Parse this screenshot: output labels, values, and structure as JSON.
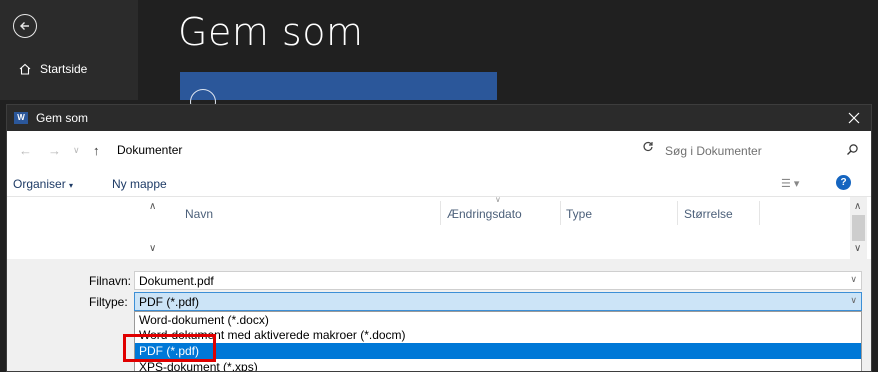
{
  "backstage": {
    "home_label": "Startside",
    "title": "Gem som"
  },
  "dialog": {
    "title": "Gem som",
    "app_icon_label": "W",
    "address": {
      "current_folder": "Dokumenter",
      "search_placeholder": "Søg i Dokumenter"
    },
    "toolbar": {
      "organize_label": "Organiser",
      "new_folder_label": "Ny mappe",
      "help_label": "?"
    },
    "columns": [
      "Navn",
      "Ændringsdato",
      "Type",
      "Størrelse"
    ],
    "filename_label": "Filnavn:",
    "filename_value": "Dokument.pdf",
    "filetype_label": "Filtype:",
    "filetype_value": "PDF (*.pdf)",
    "filetype_options": [
      "Word-dokument (*.docx)",
      "Word-dokument med aktiverede makroer (*.docm)",
      "PDF (*.pdf)",
      "XPS-dokument (*.xps)"
    ],
    "selected_option_index": 2
  },
  "colors": {
    "accent": "#0078d7",
    "word_blue": "#2b579a",
    "highlight_box": "#e00000"
  }
}
